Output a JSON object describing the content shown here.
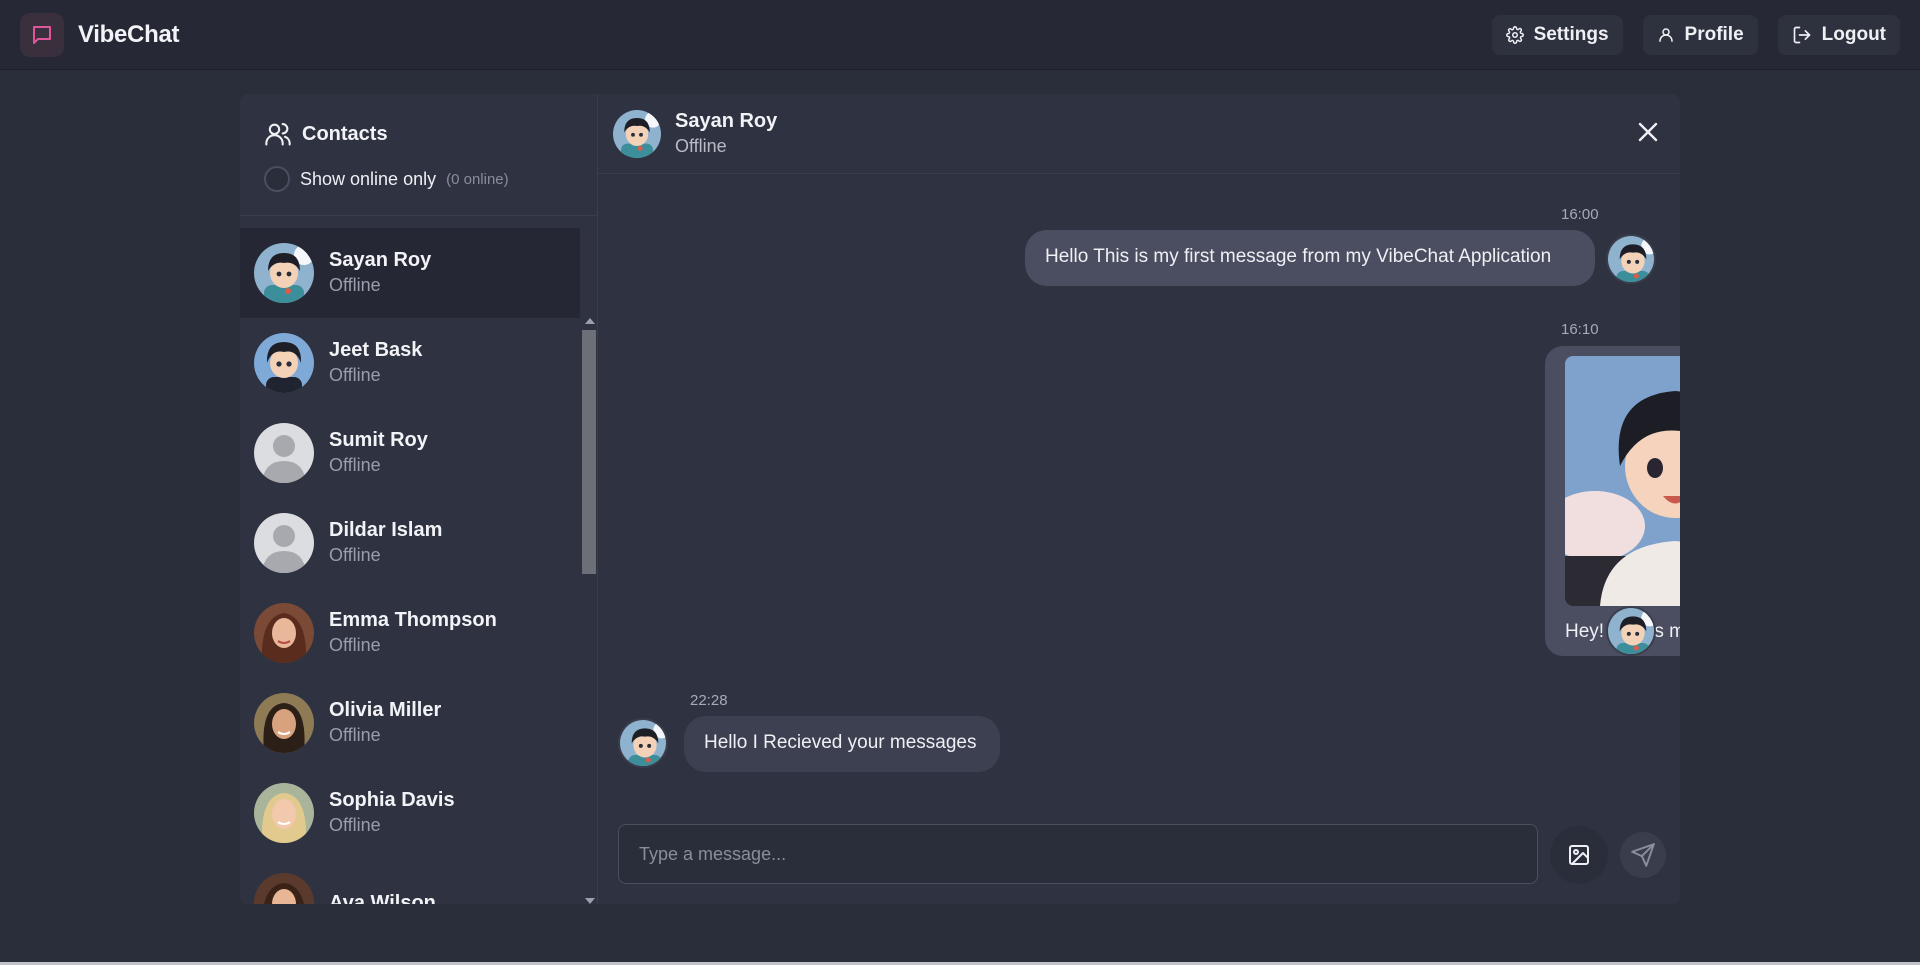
{
  "app": {
    "name": "VibeChat"
  },
  "nav": {
    "settings_label": "Settings",
    "profile_label": "Profile",
    "logout_label": "Logout"
  },
  "sidebar": {
    "title": "Contacts",
    "filter_label": "Show online only",
    "online_count": "(0 online)",
    "contacts": [
      {
        "name": "Sayan Roy",
        "status": "Offline",
        "avatar": "anime-boy"
      },
      {
        "name": "Jeet Bask",
        "status": "Offline",
        "avatar": "anime-boy-2"
      },
      {
        "name": "Sumit Roy",
        "status": "Offline",
        "avatar": "default-user"
      },
      {
        "name": "Dildar Islam",
        "status": "Offline",
        "avatar": "default-user"
      },
      {
        "name": "Emma Thompson",
        "status": "Offline",
        "avatar": "photo-woman"
      },
      {
        "name": "Olivia Miller",
        "status": "Offline",
        "avatar": "photo-woman"
      },
      {
        "name": "Sophia Davis",
        "status": "Offline",
        "avatar": "photo-woman"
      },
      {
        "name": "Ava Wilson",
        "status": "",
        "avatar": "photo-woman"
      }
    ]
  },
  "chat": {
    "contact_name": "Sayan Roy",
    "contact_status": "Offline",
    "messages": [
      {
        "direction": "outgoing",
        "time": "16:00",
        "text": "Hello This is my first message from my VibeChat Application"
      },
      {
        "direction": "outgoing",
        "time": "16:10",
        "text": "Hey! This is me in rial lyf.",
        "has_image": true
      },
      {
        "direction": "incoming",
        "time": "22:28",
        "text": "Hello I Recieved your messages"
      }
    ],
    "input_placeholder": "Type a message..."
  },
  "colors": {
    "background": "#2a2d3a",
    "panel": "#2f3240",
    "bubble_outgoing": "#4a4e60",
    "bubble_incoming": "#3d4050",
    "brand_accent": "#e0569a"
  }
}
